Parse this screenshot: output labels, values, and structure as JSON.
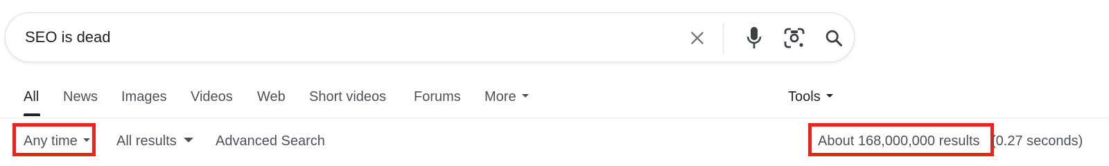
{
  "search": {
    "query": "SEO is dead",
    "icons": [
      "close-icon",
      "mic-icon",
      "lens-icon",
      "search-icon"
    ]
  },
  "tabs": [
    {
      "label": "All",
      "active": true
    },
    {
      "label": "News"
    },
    {
      "label": "Images"
    },
    {
      "label": "Videos"
    },
    {
      "label": "Web"
    },
    {
      "label": "Short videos"
    },
    {
      "label": "Forums"
    },
    {
      "label": "More"
    }
  ],
  "tools_label": "Tools",
  "filters": {
    "time": "Any time",
    "results": "All results",
    "advanced": "Advanced Search"
  },
  "stats": {
    "count": "About 168,000,000 results",
    "time": "(0.27 seconds)"
  },
  "colors": {
    "highlight": "#e8251b",
    "text_primary": "#202124",
    "text_secondary": "#4d5156"
  }
}
